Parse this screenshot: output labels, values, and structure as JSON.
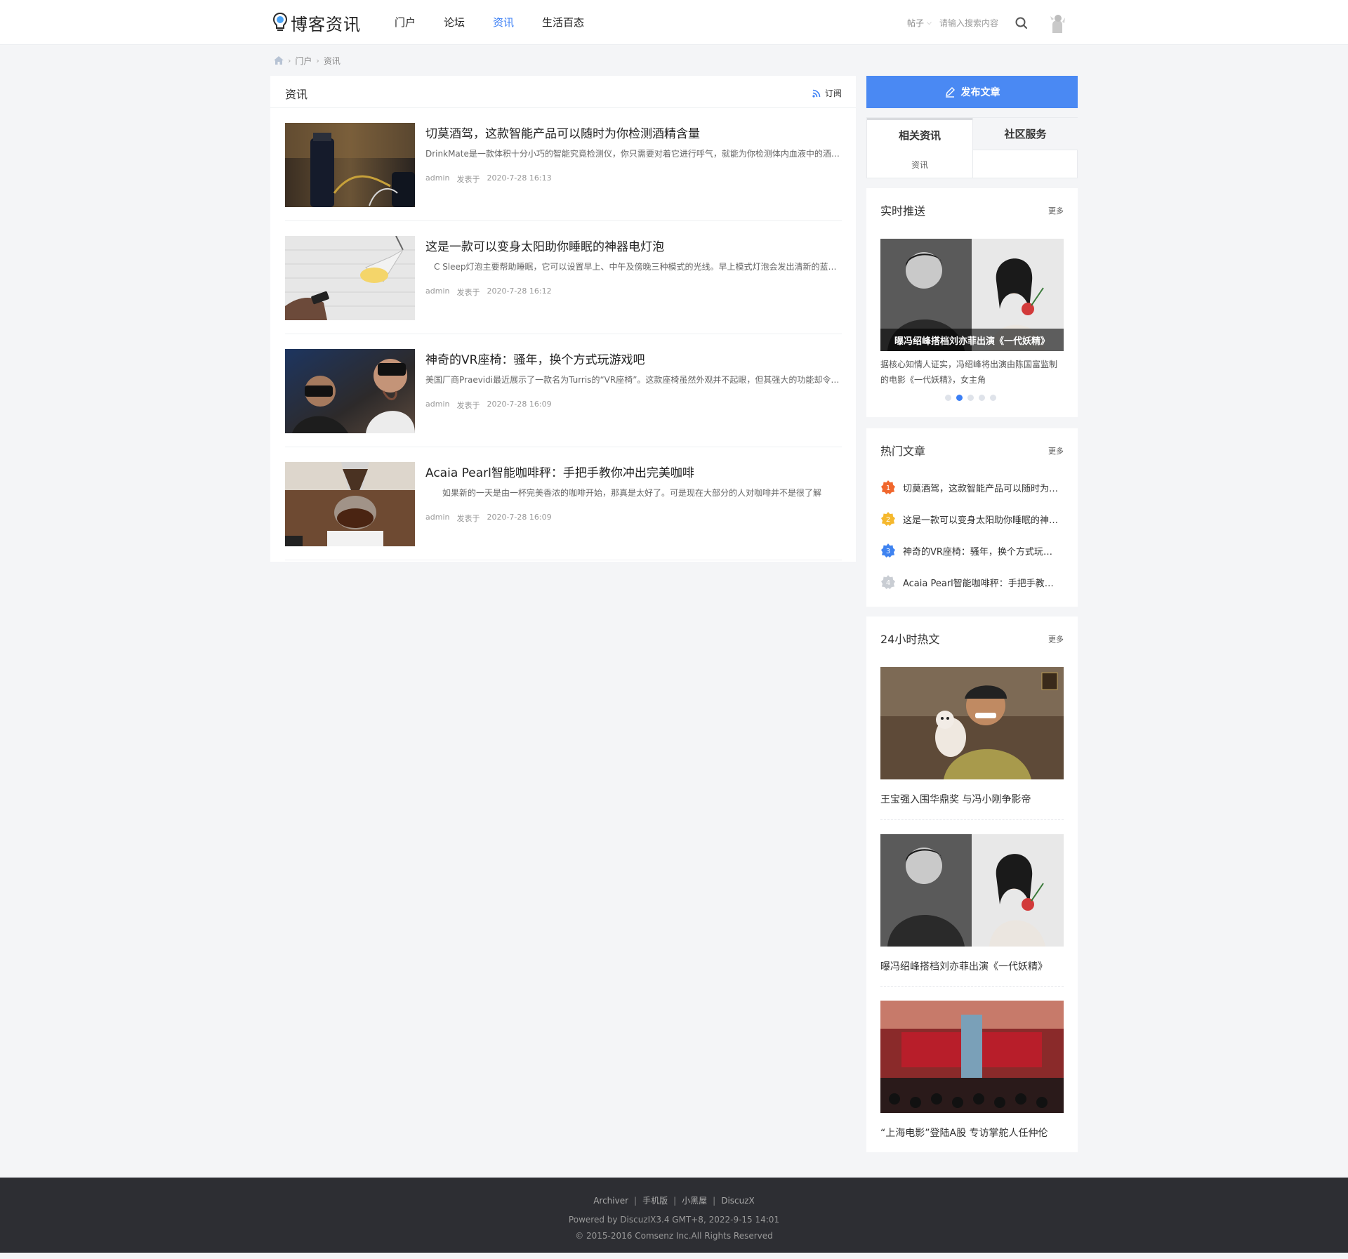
{
  "header": {
    "logo_text": "博客资讯",
    "nav": [
      {
        "label": "门户",
        "active": false
      },
      {
        "label": "论坛",
        "active": false
      },
      {
        "label": "资讯",
        "active": true
      },
      {
        "label": "生活百态",
        "active": false
      }
    ],
    "search_type": "帖子",
    "search_placeholder": "请输入搜索内容"
  },
  "breadcrumb": {
    "items": [
      "门户",
      "资讯"
    ]
  },
  "main": {
    "title": "资讯",
    "subscribe_label": "订阅",
    "articles": [
      {
        "title": "切莫酒驾，这款智能产品可以随时为你检测酒精含量",
        "summary": "DrinkMate是一款体积十分小巧的智能究竟检测仪，你只需要对着它进行呼气，就能为你检测体内血液中的酒精含量",
        "author": "admin",
        "posted_label": "发表于",
        "date": "2020-7-28 16:13"
      },
      {
        "title": "这是一款可以变身太阳助你睡眠的神器电灯泡",
        "summary": "　C Sleep灯泡主要帮助睡眠，它可以设置早上、中午及傍晚三种模式的光线。早上模式灯泡会发出清新的蓝色光线",
        "author": "admin",
        "posted_label": "发表于",
        "date": "2020-7-28 16:12"
      },
      {
        "title": "神奇的VR座椅：骚年，换个方式玩游戏吧",
        "summary": "美国厂商Praevidi最近展示了一款名为Turris的“VR座椅”。这款座椅虽然外观并不起眼，但其强大的功能却令人惊叹",
        "author": "admin",
        "posted_label": "发表于",
        "date": "2020-7-28 16:09"
      },
      {
        "title": "Acaia Pearl智能咖啡秤：手把手教你冲出完美咖啡",
        "summary": "　　如果新的一天是由一杯完美香浓的咖啡开始，那真是太好了。可是现在大部分的人对咖啡并不是很了解",
        "author": "admin",
        "posted_label": "发表于",
        "date": "2020-7-28 16:09"
      }
    ]
  },
  "sidebar": {
    "publish_label": "发布文章",
    "tabs": [
      {
        "label": "相关资讯",
        "items": [
          "资讯"
        ]
      },
      {
        "label": "社区服务",
        "items": []
      }
    ],
    "realtime": {
      "title": "实时推送",
      "more": "更多",
      "caption": "曝冯绍峰搭档刘亦菲出演《一代妖精》",
      "desc": "据核心知情人证实，冯绍峰将出演由陈国富监制的电影《一代妖精》，女主角",
      "dot_count": 5,
      "active_dot": 1
    },
    "hot": {
      "title": "热门文章",
      "more": "更多",
      "items": [
        {
          "rank": "1",
          "text": "切莫酒驾，这款智能产品可以随时为你检测酒精含量",
          "color": "#f0672d"
        },
        {
          "rank": "2",
          "text": "这是一款可以变身太阳助你睡眠的神器电灯泡",
          "color": "#f5b82e"
        },
        {
          "rank": "3",
          "text": "神奇的VR座椅：骚年，换个方式玩游戏吧",
          "color": "#3f83f0"
        },
        {
          "rank": "4",
          "text": "Acaia Pearl智能咖啡秤：手把手教你冲出完美咖啡",
          "color": "#c9cdd3"
        }
      ]
    },
    "h24": {
      "title": "24小时热文",
      "more": "更多",
      "items": [
        {
          "caption": "王宝强入围华鼎奖 与冯小刚争影帝"
        },
        {
          "caption": "曝冯绍峰搭档刘亦菲出演《一代妖精》"
        },
        {
          "caption": "“上海电影”登陆A股 专访掌舵人任仲伦"
        }
      ]
    }
  },
  "footer": {
    "links": [
      "Archiver",
      "手机版",
      "小黑屋",
      "DiscuzX"
    ],
    "powered": "Powered by DiscuzIX3.4 GMT+8, 2022-9-15 14:01",
    "copyright": "© 2015-2016 Comsenz Inc.All Rights Reserved"
  },
  "colors": {
    "accent": "#3b7ff5",
    "publish_button": "#4a89f3",
    "footer_bg": "#2d2e33",
    "page_bg": "#f4f5f7"
  }
}
